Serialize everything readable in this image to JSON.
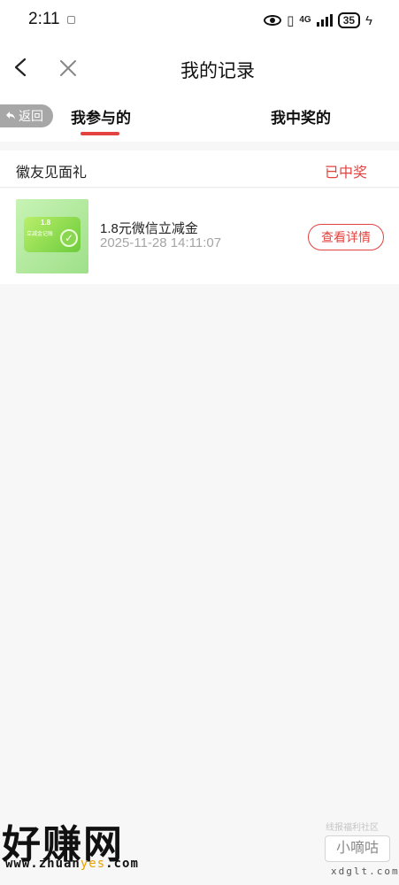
{
  "status_bar": {
    "time": "2:11",
    "network": "4G",
    "battery": "35"
  },
  "header": {
    "title": "我的记录"
  },
  "tabs": {
    "return_label": "返回",
    "items": [
      {
        "label": "我参与的"
      },
      {
        "label": "我中奖的"
      }
    ]
  },
  "section": {
    "name": "徽友见面礼",
    "status": "已中奖"
  },
  "record": {
    "title": "1.8元微信立减金",
    "time": "2025-11-28 14:11:07",
    "button_label": "查看详情",
    "thumb_amount": "1.8",
    "thumb_caption": "立减金记账"
  },
  "watermarks": {
    "left_main": "好赚网",
    "left_url_a": "www.zhuan",
    "left_url_b": "yes",
    "left_url_c": ".com",
    "right_top": "线报福利社区",
    "right_badge": "小嘀咕",
    "right_url": "xdglt.com"
  },
  "colors": {
    "accent": "#e2433f",
    "return_pill": "#a7a7a7",
    "muted_text": "#a5a5a5",
    "background": "#f7f7f7"
  },
  "icons": {
    "back": "chevron-left-icon",
    "close": "close-icon",
    "return": "return-arrow-icon",
    "check": "check-icon"
  }
}
